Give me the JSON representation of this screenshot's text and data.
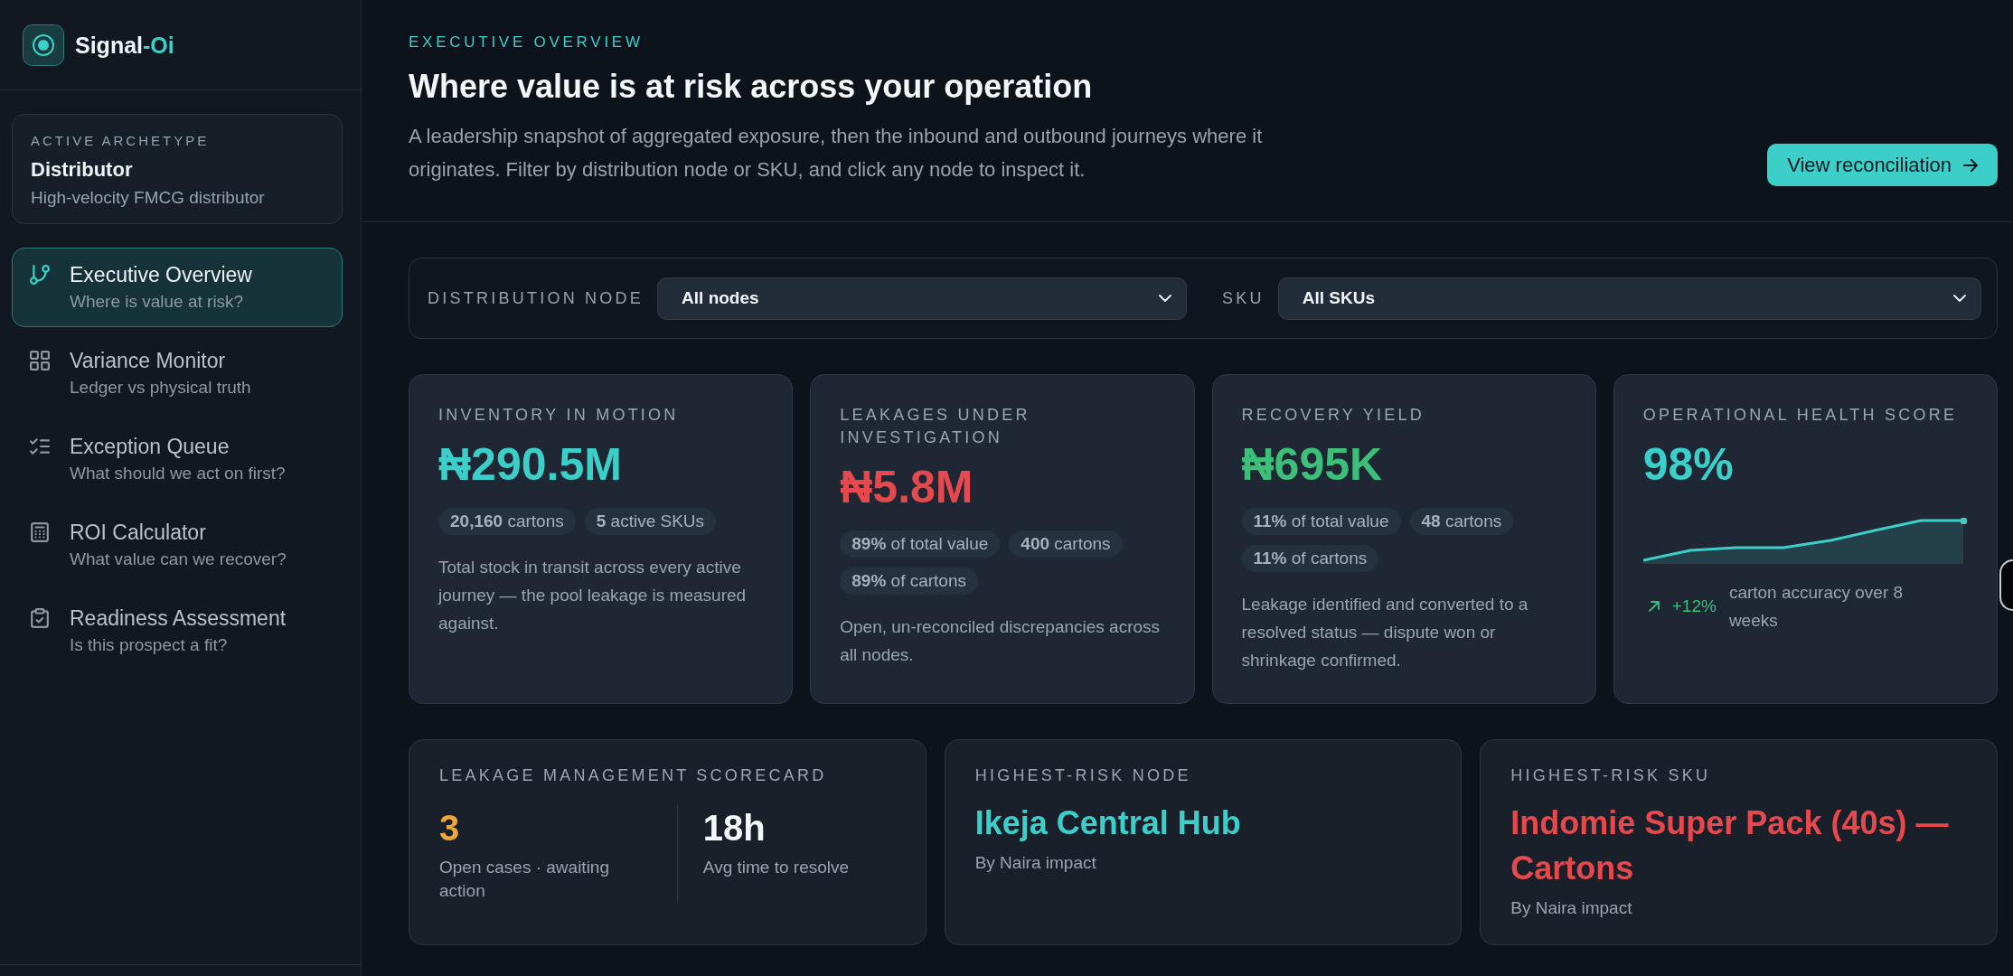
{
  "sidebar": {
    "brand": {
      "name": "Signal",
      "accent": "-Oi"
    },
    "archetype": {
      "label": "ACTIVE ARCHETYPE",
      "name": "Distributor",
      "description": "High-velocity FMCG distributor"
    },
    "nav": [
      {
        "title": "Executive Overview",
        "subtitle": "Where is value at risk?",
        "selected": true
      },
      {
        "title": "Variance Monitor",
        "subtitle": "Ledger vs physical truth",
        "selected": false
      },
      {
        "title": "Exception Queue",
        "subtitle": "What should we act on first?",
        "selected": false
      },
      {
        "title": "ROI Calculator",
        "subtitle": "What value can we recover?",
        "selected": false
      },
      {
        "title": "Readiness Assessment",
        "subtitle": "Is this prospect a fit?",
        "selected": false
      }
    ]
  },
  "header": {
    "eyebrow": "EXECUTIVE OVERVIEW",
    "title": "Where value is at risk across your operation",
    "description": "A leadership snapshot of aggregated exposure, then the inbound and outbound journeys where it originates. Filter by distribution node or SKU, and click any node to inspect it.",
    "button": "View reconciliation"
  },
  "filters": [
    {
      "label": "DISTRIBUTION NODE",
      "value": "All nodes"
    },
    {
      "label": "SKU",
      "value": "All SKUs"
    }
  ],
  "metrics": [
    {
      "kind": "stat",
      "label": "INVENTORY IN MOTION",
      "value": "₦290.5M",
      "color": "#3ccfca",
      "chips": [
        "**20,160** cartons",
        "**5** active SKUs"
      ],
      "description": "Total stock in transit across every active journey — the pool leakage is measured against."
    },
    {
      "kind": "stat",
      "label": "LEAKAGES UNDER INVESTIGATION",
      "value": "₦5.8M",
      "color": "#e5484d",
      "chips": [
        "**89%** of total value",
        "**400** cartons",
        "**89%** of cartons"
      ],
      "description": "Open, un-reconciled discrepancies across all nodes."
    },
    {
      "kind": "stat",
      "label": "RECOVERY YIELD",
      "value": "₦695K",
      "color": "#3dbf7a",
      "chips": [
        "**11%** of total value",
        "**48** cartons",
        "**11%** of cartons"
      ],
      "description": "Leakage identified and converted to a resolved status — dispute won or shrinkage confirmed."
    },
    {
      "kind": "trend",
      "label": "OPERATIONAL HEALTH SCORE",
      "value": "98%",
      "color": "#3ccfca",
      "trend": {
        "delta": "+12%",
        "caption": "carton accuracy over 8 weeks"
      }
    }
  ],
  "scorecard": {
    "label": "LEAKAGE MANAGEMENT SCORECARD",
    "items": [
      {
        "value": "3",
        "caption": "Open cases · awaiting action",
        "color": "#f0a63a"
      },
      {
        "value": "18h",
        "caption": "Avg time to resolve",
        "color": "#f4f6f8"
      }
    ]
  },
  "highlights": [
    {
      "label": "HIGHEST-RISK NODE",
      "value": "Ikeja Central Hub",
      "caption": "By Naira impact",
      "color": "#3ccfca"
    },
    {
      "label": "HIGHEST-RISK SKU",
      "value": "Indomie Super Pack (40s) — Cartons",
      "caption": "By Naira impact",
      "color": "#e5484d"
    }
  ]
}
